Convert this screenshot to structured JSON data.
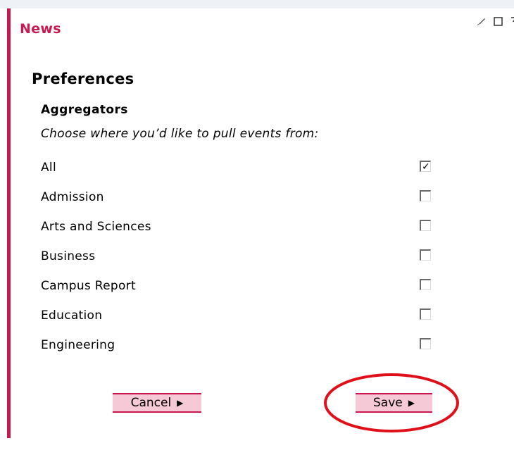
{
  "portlet": {
    "title": "News",
    "controls": [
      {
        "name": "edit-icon"
      },
      {
        "name": "maximize-icon"
      },
      {
        "name": "pin-to-top-icon"
      }
    ]
  },
  "preferences": {
    "heading": "Preferences",
    "section_title": "Aggregators",
    "prompt": "Choose where you’d like to pull events from:",
    "options": [
      {
        "label": "All",
        "checked": true
      },
      {
        "label": "Admission",
        "checked": false
      },
      {
        "label": "Arts and Sciences",
        "checked": false
      },
      {
        "label": "Business",
        "checked": false
      },
      {
        "label": "Campus Report",
        "checked": false
      },
      {
        "label": "Education",
        "checked": false
      },
      {
        "label": "Engineering",
        "checked": false
      }
    ]
  },
  "buttons": {
    "cancel_label": "Cancel",
    "save_label": "Save"
  },
  "colors": {
    "accent": "#c8184f",
    "button_bg": "#f5c9d6",
    "annotation": "#e0101a"
  }
}
